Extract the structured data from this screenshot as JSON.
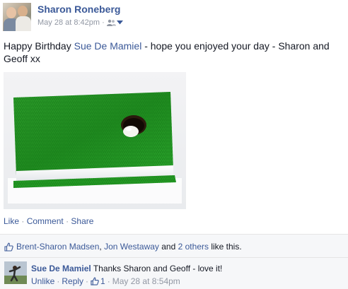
{
  "post": {
    "author": "Sharon Roneberg",
    "timestamp": "May 28 at 8:42pm",
    "separator": "·",
    "audience_icon": "friends-icon",
    "text_prefix": "Happy Birthday ",
    "tagged_name": "Sue De Mamiel",
    "text_suffix": " - hope you enjoyed your day - Sharon and Geoff xx",
    "image_alt": "cake-photo"
  },
  "actions": {
    "like": "Like",
    "comment": "Comment",
    "share": "Share",
    "sep": "·"
  },
  "likes": {
    "name1": "Brent-Sharon Madsen",
    "comma": ",",
    "name2": "Jon Westaway",
    "and": "and",
    "others": "2 others",
    "suffix": "like this."
  },
  "comment": {
    "author": "Sue De Mamiel",
    "text": "Thanks Sharon and Geoff - love it!",
    "unlike": "Unlike",
    "reply": "Reply",
    "like_count": "1",
    "timestamp": "May 28 at 8:54pm",
    "sep": "·"
  },
  "colors": {
    "link": "#3b5998",
    "meta_gray": "#9197a3",
    "text": "#141823",
    "bar_bg": "#f6f7f9"
  }
}
